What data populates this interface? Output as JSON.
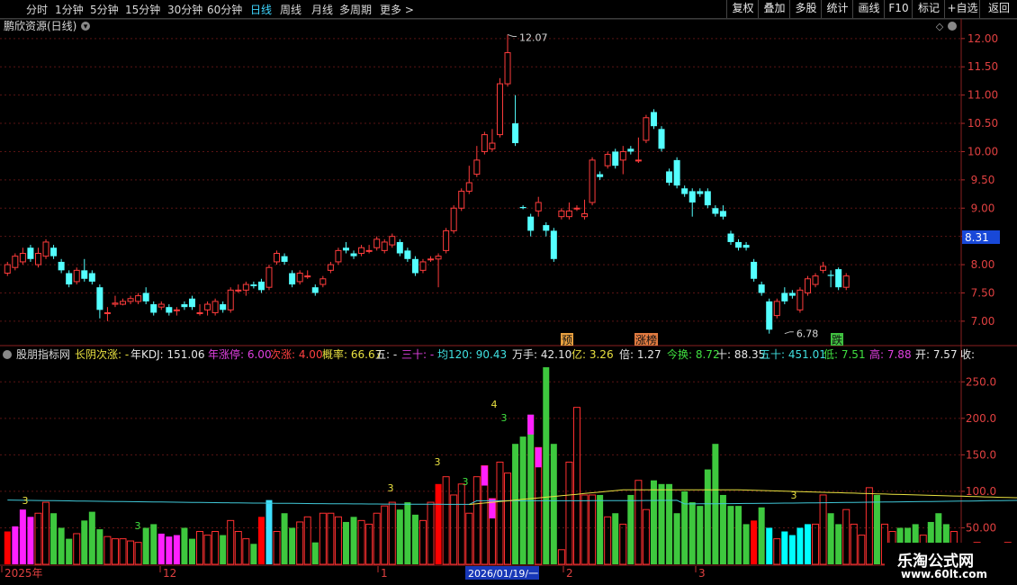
{
  "toolbar": {
    "periods": [
      "分时",
      "1分钟",
      "5分钟",
      "15分钟",
      "30分钟",
      "60分钟",
      "日线",
      "周线",
      "月线",
      "多周期",
      "更多 >"
    ],
    "active": "日线",
    "right_buttons": [
      "复权",
      "叠加",
      "多股",
      "统计",
      "画线",
      "F10",
      "标记",
      "+自选",
      "返回"
    ]
  },
  "main": {
    "title": "鹏欣资源(日线)",
    "high_label": "12.07",
    "low_label": "6.78",
    "current_price": "8.31",
    "price_ticks": [
      "12.00",
      "11.50",
      "11.00",
      "10.50",
      "10.00",
      "9.50",
      "9.00",
      "8.50",
      "8.00",
      "7.50",
      "7.00"
    ],
    "markers": [
      "预",
      "涨榜",
      "跌"
    ]
  },
  "indicator": {
    "title": "股朋指标网",
    "fields": [
      {
        "text": "长阴次涨: -",
        "color": "#e8e040"
      },
      {
        "text": "年KDJ: 151.06",
        "color": "#e8e8e8"
      },
      {
        "text": "年涨停: 6.00",
        "color": "#e040e0"
      },
      {
        "text": "次涨: 4.00",
        "color": "#ff4040"
      },
      {
        "text": "概率: 66.67",
        "color": "#e8e040"
      },
      {
        "text": "五: -",
        "color": "#e8e8e8"
      },
      {
        "text": "三十: -",
        "color": "#e040e0"
      },
      {
        "text": "均120: 90.43",
        "color": "#40e0e0"
      },
      {
        "text": "万手: 42.10",
        "color": "#e8e8e8"
      },
      {
        "text": "亿: 3.26",
        "color": "#e8e040"
      },
      {
        "text": "倍: 1.27",
        "color": "#e8e8e8"
      },
      {
        "text": "今换: 8.72",
        "color": "#40e040"
      },
      {
        "text": "十: 88.35",
        "color": "#e8e8e8"
      },
      {
        "text": "五十: 451.01",
        "color": "#40e0e0"
      },
      {
        "text": "低: 7.51",
        "color": "#40e040"
      },
      {
        "text": "高: 7.88",
        "color": "#e040e0"
      },
      {
        "text": "开: 7.57",
        "color": "#e8e8e8"
      },
      {
        "text": "收:",
        "color": "#e8e8e8"
      }
    ],
    "ticks": [
      "250.0",
      "200.0",
      "150.0",
      "100.0",
      "50.00"
    ],
    "bar_numbers": [
      "3",
      "3",
      "3",
      "3",
      "3",
      "4",
      "3",
      "3"
    ]
  },
  "axis": {
    "dates": [
      "2025年",
      "12",
      "1",
      "2026/01/19/一",
      "2",
      "3"
    ]
  },
  "watermark": {
    "line1": "乐淘公式网",
    "line2": "www.60lt.com"
  },
  "chart_data": [
    {
      "type": "candlestick",
      "title": "鹏欣资源(日线)",
      "y_range": [
        6.6,
        12.3
      ],
      "candles": [
        [
          7.85,
          8.0,
          8.05,
          7.8
        ],
        [
          7.95,
          8.15,
          8.2,
          7.9
        ],
        [
          8.05,
          8.2,
          8.3,
          8.0
        ],
        [
          8.3,
          8.1,
          8.35,
          8.05
        ],
        [
          8.0,
          8.2,
          8.3,
          7.95
        ],
        [
          8.15,
          8.4,
          8.45,
          8.1
        ],
        [
          8.3,
          8.15,
          8.35,
          8.1
        ],
        [
          8.05,
          7.9,
          8.1,
          7.85
        ],
        [
          7.85,
          7.65,
          7.9,
          7.6
        ],
        [
          7.7,
          7.9,
          7.95,
          7.65
        ],
        [
          7.9,
          7.75,
          8.1,
          7.7
        ],
        [
          7.85,
          7.7,
          7.9,
          7.65
        ],
        [
          7.6,
          7.2,
          7.65,
          7.05
        ],
        [
          7.15,
          7.15,
          7.25,
          7.0
        ],
        [
          7.3,
          7.32,
          7.45,
          7.25
        ],
        [
          7.3,
          7.35,
          7.4,
          7.28
        ],
        [
          7.35,
          7.4,
          7.45,
          7.3
        ],
        [
          7.35,
          7.45,
          7.5,
          7.3
        ],
        [
          7.5,
          7.35,
          7.6,
          7.3
        ],
        [
          7.3,
          7.15,
          7.35,
          7.1
        ],
        [
          7.25,
          7.3,
          7.35,
          7.2
        ],
        [
          7.25,
          7.15,
          7.3,
          7.1
        ],
        [
          7.2,
          7.2,
          7.25,
          7.1
        ],
        [
          7.3,
          7.25,
          7.35,
          7.2
        ],
        [
          7.4,
          7.25,
          7.45,
          7.2
        ],
        [
          7.15,
          7.15,
          7.3,
          7.1
        ],
        [
          7.2,
          7.3,
          7.35,
          7.1
        ],
        [
          7.15,
          7.35,
          7.4,
          7.1
        ],
        [
          7.3,
          7.2,
          7.35,
          7.15
        ],
        [
          7.2,
          7.55,
          7.6,
          7.15
        ],
        [
          7.55,
          7.55,
          7.65,
          7.5
        ],
        [
          7.55,
          7.65,
          7.7,
          7.45
        ],
        [
          7.65,
          7.62,
          7.7,
          7.58
        ],
        [
          7.7,
          7.55,
          7.75,
          7.5
        ],
        [
          7.6,
          7.95,
          8.0,
          7.55
        ],
        [
          8.05,
          8.2,
          8.25,
          8.0
        ],
        [
          8.15,
          8.05,
          8.2,
          8.0
        ],
        [
          7.85,
          7.65,
          7.9,
          7.6
        ],
        [
          7.7,
          7.85,
          7.9,
          7.65
        ],
        [
          7.8,
          7.8,
          7.9,
          7.75
        ],
        [
          7.6,
          7.5,
          7.65,
          7.45
        ],
        [
          7.65,
          7.75,
          7.8,
          7.6
        ],
        [
          7.9,
          8.0,
          8.05,
          7.85
        ],
        [
          8.05,
          8.25,
          8.3,
          8.0
        ],
        [
          8.3,
          8.25,
          8.4,
          8.2
        ],
        [
          8.2,
          8.15,
          8.25,
          8.1
        ],
        [
          8.2,
          8.3,
          8.35,
          8.15
        ],
        [
          8.25,
          8.25,
          8.35,
          8.2
        ],
        [
          8.3,
          8.45,
          8.5,
          8.25
        ],
        [
          8.25,
          8.4,
          8.45,
          8.2
        ],
        [
          8.35,
          8.5,
          8.55,
          8.3
        ],
        [
          8.4,
          8.2,
          8.45,
          8.15
        ],
        [
          8.25,
          8.1,
          8.3,
          8.05
        ],
        [
          8.1,
          7.85,
          8.15,
          7.8
        ],
        [
          7.9,
          8.05,
          8.1,
          7.85
        ],
        [
          8.1,
          8.1,
          8.15,
          8.05
        ],
        [
          8.1,
          8.15,
          8.2,
          7.6
        ],
        [
          8.25,
          8.6,
          8.65,
          8.2
        ],
        [
          8.6,
          9.0,
          9.05,
          8.55
        ],
        [
          9.0,
          9.3,
          9.35,
          8.95
        ],
        [
          9.3,
          9.45,
          9.75,
          9.25
        ],
        [
          9.6,
          9.85,
          10.1,
          9.55
        ],
        [
          10.0,
          10.3,
          10.35,
          9.95
        ],
        [
          10.05,
          10.15,
          10.4,
          10.0
        ],
        [
          10.3,
          11.2,
          11.3,
          10.25
        ],
        [
          11.2,
          11.75,
          12.07,
          11.15
        ],
        [
          10.5,
          10.15,
          11.0,
          10.1
        ],
        [
          9.02,
          9.0,
          9.05,
          8.98
        ],
        [
          8.85,
          8.6,
          8.9,
          8.5
        ],
        [
          8.95,
          9.1,
          9.2,
          8.85
        ],
        [
          8.7,
          8.6,
          8.75,
          8.5
        ],
        [
          8.6,
          8.1,
          8.65,
          8.05
        ],
        [
          8.85,
          8.95,
          9.0,
          8.8
        ],
        [
          8.85,
          8.95,
          9.1,
          8.8
        ],
        [
          9.0,
          9.0,
          9.05,
          8.95
        ],
        [
          8.85,
          8.9,
          9.15,
          8.8
        ],
        [
          9.1,
          9.85,
          9.9,
          9.05
        ],
        [
          9.6,
          9.55,
          9.65,
          9.5
        ],
        [
          9.75,
          9.95,
          10.0,
          9.7
        ],
        [
          10.0,
          9.75,
          10.05,
          9.7
        ],
        [
          9.85,
          10.0,
          10.1,
          9.6
        ],
        [
          10.05,
          10.0,
          10.1,
          9.95
        ],
        [
          9.85,
          9.85,
          10.25,
          9.8
        ],
        [
          10.2,
          10.6,
          10.65,
          10.15
        ],
        [
          10.7,
          10.45,
          10.75,
          10.4
        ],
        [
          10.4,
          10.05,
          10.45,
          10.0
        ],
        [
          9.65,
          9.45,
          9.7,
          9.4
        ],
        [
          9.85,
          9.4,
          9.9,
          9.35
        ],
        [
          9.35,
          9.25,
          9.4,
          9.2
        ],
        [
          9.3,
          9.1,
          9.35,
          8.85
        ],
        [
          9.3,
          9.25,
          9.35,
          9.2
        ],
        [
          9.3,
          9.05,
          9.35,
          9.0
        ],
        [
          9.0,
          8.9,
          9.05,
          8.85
        ],
        [
          8.95,
          8.85,
          9.05,
          8.8
        ],
        [
          8.55,
          8.4,
          8.6,
          8.35
        ],
        [
          8.4,
          8.3,
          8.45,
          8.25
        ],
        [
          8.35,
          8.3,
          8.4,
          8.25
        ],
        [
          8.05,
          7.75,
          8.1,
          7.7
        ],
        [
          7.65,
          7.5,
          7.7,
          7.45
        ],
        [
          7.35,
          6.85,
          7.4,
          6.78
        ],
        [
          7.1,
          7.35,
          7.4,
          7.05
        ],
        [
          7.5,
          7.35,
          7.6,
          7.3
        ],
        [
          7.5,
          7.45,
          7.55,
          7.4
        ],
        [
          7.2,
          7.55,
          7.6,
          7.15
        ],
        [
          7.5,
          7.75,
          7.8,
          7.45
        ],
        [
          7.65,
          7.8,
          7.85,
          7.6
        ],
        [
          7.9,
          7.97,
          8.05,
          7.85
        ],
        [
          7.82,
          7.8,
          7.9,
          7.6
        ],
        [
          7.92,
          7.6,
          7.95,
          7.55
        ],
        [
          7.6,
          7.8,
          7.85,
          7.55
        ]
      ]
    },
    {
      "type": "bar",
      "title": "股朋指标网",
      "y_range": [
        0,
        275
      ],
      "series": [
        {
          "values": [
            45,
            52,
            75,
            65,
            70,
            85,
            70,
            50,
            35,
            42,
            60,
            72,
            48,
            38,
            35,
            35,
            32,
            30,
            50,
            55,
            42,
            38,
            40,
            50,
            35,
            45,
            40,
            45,
            40,
            60,
            45,
            35,
            28,
            65,
            88,
            45,
            70,
            50,
            58,
            65,
            30,
            70,
            70,
            65,
            58,
            65,
            60,
            55,
            70,
            80,
            85,
            75,
            85,
            68,
            60,
            85,
            110,
            120,
            95,
            110,
            70,
            120,
            135,
            90,
            140,
            125,
            165,
            175,
            205,
            160,
            270,
            165,
            20,
            140,
            215,
            95,
            95,
            95,
            65,
            70,
            55,
            95,
            115,
            75,
            115,
            110,
            110,
            70,
            100,
            85,
            80,
            130,
            165,
            95,
            80,
            80,
            55,
            60,
            78,
            50,
            35,
            45,
            40,
            50,
            55,
            55,
            95,
            70,
            55,
            75,
            55,
            40,
            105,
            95,
            55,
            45,
            50,
            50,
            55,
            40,
            58,
            70,
            55,
            45,
            25,
            25,
            30,
            20,
            20,
            25,
            30,
            25,
            25,
            30,
            20
          ]
        }
      ]
    }
  ]
}
